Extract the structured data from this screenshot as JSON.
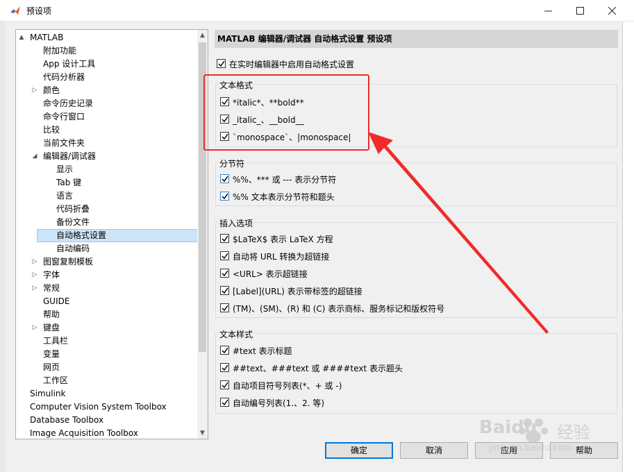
{
  "window": {
    "title": "预设项",
    "controls": [
      "minimize",
      "maximize",
      "close"
    ]
  },
  "tree": {
    "items": [
      {
        "label": "MATLAB",
        "expander": "▲"
      },
      {
        "label": "附加功能"
      },
      {
        "label": "App 设计工具"
      },
      {
        "label": "代码分析器"
      },
      {
        "label": "颜色",
        "expander": "▷"
      },
      {
        "label": "命令历史记录"
      },
      {
        "label": "命令行窗口"
      },
      {
        "label": "比较"
      },
      {
        "label": "当前文件夹"
      },
      {
        "label": "编辑器/调试器",
        "expander": "◢"
      },
      {
        "label": "显示"
      },
      {
        "label": "Tab 键"
      },
      {
        "label": "语言"
      },
      {
        "label": "代码折叠"
      },
      {
        "label": "备份文件"
      },
      {
        "label": "自动格式设置",
        "selected": true
      },
      {
        "label": "自动编码"
      },
      {
        "label": "图窗复制模板",
        "expander": "▷"
      },
      {
        "label": "字体",
        "expander": "▷"
      },
      {
        "label": "常规",
        "expander": "▷"
      },
      {
        "label": "GUIDE"
      },
      {
        "label": "帮助"
      },
      {
        "label": "键盘",
        "expander": "▷"
      },
      {
        "label": "工具栏"
      },
      {
        "label": "变量"
      },
      {
        "label": "网页"
      },
      {
        "label": "工作区"
      },
      {
        "label": "Simulink"
      },
      {
        "label": "Computer Vision System Toolbox"
      },
      {
        "label": "Database Toolbox"
      },
      {
        "label": "Image Acquisition Toolbox"
      }
    ]
  },
  "panel": {
    "header": "MATLAB 编辑器/调试器 自动格式设置 预设项",
    "enable_label": "在实时编辑器中启用自动格式设置",
    "groups": [
      {
        "title": "文本格式",
        "options": [
          {
            "label": "*italic*、**bold**",
            "checked": true
          },
          {
            "label": "_italic_、__bold__",
            "checked": true
          },
          {
            "label": "`monospace`、|monospace|",
            "checked": true
          }
        ]
      },
      {
        "title": "分节符",
        "options": [
          {
            "label": "%%、*** 或 --- 表示分节符",
            "checked": true
          },
          {
            "label": "%% 文本表示分节符和题头",
            "checked": true
          }
        ]
      },
      {
        "title": "插入选项",
        "options": [
          {
            "label": "$LaTeX$ 表示 LaTeX 方程",
            "checked": true
          },
          {
            "label": "自动将 URL 转换为超链接",
            "checked": true
          },
          {
            "label": "<URL> 表示超链接",
            "checked": true
          },
          {
            "label": "[Label](URL) 表示带标签的超链接",
            "checked": true
          },
          {
            "label": "(TM)、(SM)、(R) 和 (C) 表示商标、服务标记和版权符号",
            "checked": true
          }
        ]
      },
      {
        "title": "文本样式",
        "options": [
          {
            "label": "#text 表示标题",
            "checked": true
          },
          {
            "label": "##text、###text 或 ####text 表示题头",
            "checked": true
          },
          {
            "label": "自动项目符号列表(*、+ 或 -)",
            "checked": true
          },
          {
            "label": "自动编号列表(1.、2. 等)",
            "checked": true
          }
        ]
      }
    ]
  },
  "buttons": {
    "ok": "确定",
    "cancel": "取消",
    "apply": "应用",
    "help": "帮助"
  },
  "watermark": {
    "brand": "Baidu",
    "suffix": "经验",
    "url": "jingyan.baidu.com"
  },
  "colors": {
    "annotation": "#ef2b2b",
    "selection": "#cce4f7",
    "default_button_border": "#0078d7"
  }
}
